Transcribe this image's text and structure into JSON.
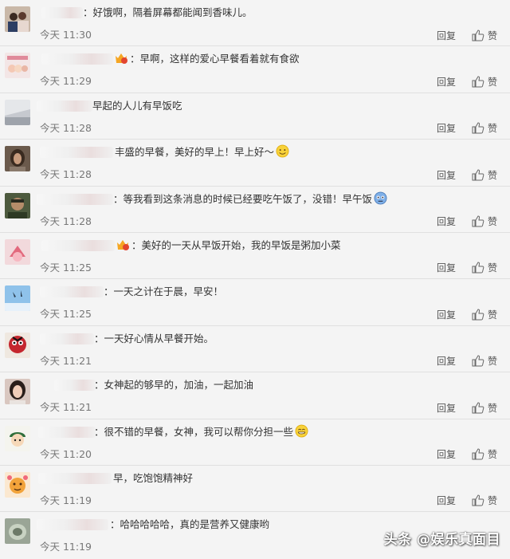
{
  "comments": [
    {
      "text": "：好饿啊，隔着屏幕都能闻到香味儿。",
      "time": "今天 11:30"
    },
    {
      "text": "：早啊，这样的爱心早餐看着就有食欲",
      "time": "今天 11:29"
    },
    {
      "text": "早起的人儿有早饭吃",
      "time": "今天 11:28"
    },
    {
      "text": "丰盛的早餐，美好的早上！早上好～",
      "time": "今天 11:28"
    },
    {
      "text": "：等我看到这条消息的时候已经要吃午饭了，没错！早午饭",
      "time": "今天 11:28"
    },
    {
      "text": "：美好的一天从早饭开始，我的早饭是粥加小菜",
      "time": "今天 11:25"
    },
    {
      "text": "：一天之计在于晨，早安！",
      "time": "今天 11:25"
    },
    {
      "text": "：一天好心情从早餐开始。",
      "time": "今天 11:21"
    },
    {
      "text": "：女神起的够早的，加油，一起加油",
      "time": "今天 11:21"
    },
    {
      "text": "：很不错的早餐，女神，我可以帮你分担一些",
      "time": "今天 11:20"
    },
    {
      "text": "早，吃饱饱精神好",
      "time": "今天 11:19"
    },
    {
      "text": "：哈哈哈哈哈，真的是营养又健康哟",
      "time": "今天 11:19"
    }
  ],
  "actions": {
    "reply": "回复",
    "like": "赞"
  },
  "watermark": "头条 @娱乐真面目",
  "colors": {
    "background": "#f4f4f4",
    "text": "#333333",
    "time": "#777777",
    "divider": "#e0e0e0"
  }
}
